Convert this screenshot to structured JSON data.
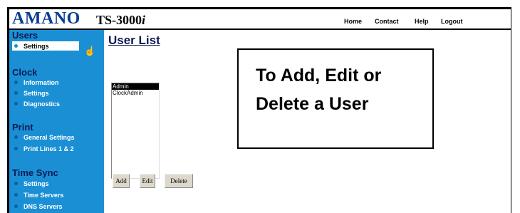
{
  "header": {
    "brand": "AMANO",
    "model": "TS-3000",
    "model_suffix": "i",
    "nav": [
      "Home",
      "Contact",
      "Help",
      "Logout"
    ]
  },
  "sidebar": {
    "sections": [
      {
        "title": "Users",
        "items": [
          "Settings"
        ]
      },
      {
        "title": "Clock",
        "items": [
          "Information",
          "Settings",
          "Diagnostics"
        ]
      },
      {
        "title": "Print",
        "items": [
          "General Settings",
          "Print Lines 1 & 2"
        ]
      },
      {
        "title": "Time Sync",
        "items": [
          "Settings",
          "Time Servers",
          "DNS Servers"
        ]
      }
    ],
    "active": "Users > Settings"
  },
  "main": {
    "title": "User List",
    "users": [
      "Admin",
      "ClockAdmin"
    ],
    "selected_user": "Admin",
    "buttons": {
      "add": "Add",
      "edit": "Edit",
      "delete": "Delete"
    }
  },
  "callout": {
    "line1": "To Add, Edit or",
    "line2": "Delete a User"
  },
  "colors": {
    "sidebar": "#1a8fd4",
    "heading": "#0b1a55",
    "brand": "#0a3d91"
  }
}
